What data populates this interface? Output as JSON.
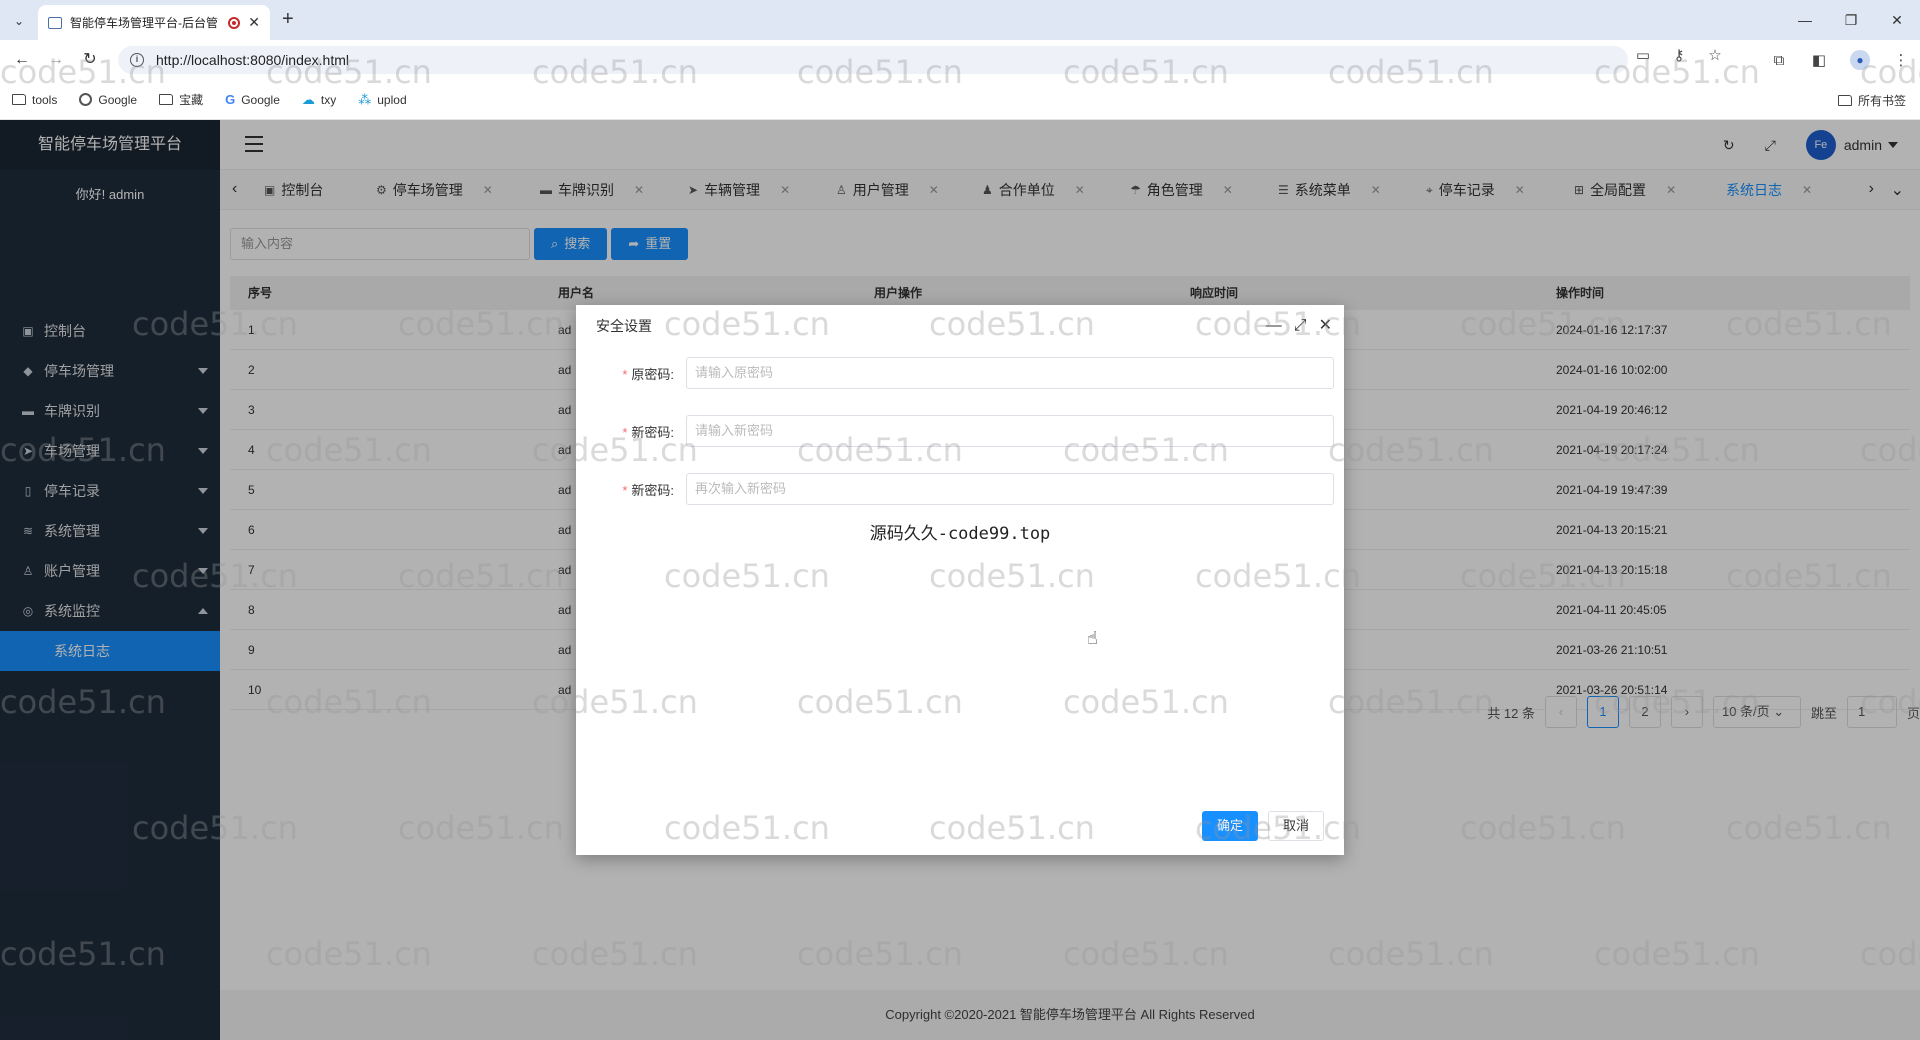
{
  "browser": {
    "tab_title": "智能停车场管理平台-后台管",
    "url": "http://localhost:8080/index.html",
    "bookmarks": [
      "tools",
      "Google",
      "宝藏",
      "Google",
      "txy",
      "uplod"
    ],
    "all_bookmarks": "所有书签"
  },
  "app": {
    "brand": "智能停车场管理平台",
    "greeting": "你好! admin",
    "user": "admin",
    "avatar_text": "Fe"
  },
  "sidebar": {
    "items": [
      {
        "label": "控制台",
        "icon": "dashboard-icon"
      },
      {
        "label": "停车场管理",
        "icon": "diamond-icon"
      },
      {
        "label": "车牌识别",
        "icon": "camera-icon"
      },
      {
        "label": "车场管理",
        "icon": "send-icon"
      },
      {
        "label": "停车记录",
        "icon": "doc-icon"
      },
      {
        "label": "系统管理",
        "icon": "layers-icon"
      },
      {
        "label": "账户管理",
        "icon": "user-icon"
      },
      {
        "label": "系统监控",
        "icon": "camera-icon"
      }
    ],
    "sub_active": "系统日志"
  },
  "tabs": [
    "控制台",
    "停车场管理",
    "车牌识别",
    "车辆管理",
    "用户管理",
    "合作单位",
    "角色管理",
    "系统菜单",
    "停车记录",
    "全局配置",
    "系统日志"
  ],
  "search": {
    "placeholder": "输入内容",
    "search_label": "搜索",
    "reset_label": "重置"
  },
  "table": {
    "headers": [
      "序号",
      "用户名",
      "用户操作",
      "响应时间",
      "操作时间"
    ],
    "rows": [
      {
        "no": "1",
        "user": "ad",
        "time": "2024-01-16 12:17:37"
      },
      {
        "no": "2",
        "user": "ad",
        "time": "2024-01-16 10:02:00"
      },
      {
        "no": "3",
        "user": "ad",
        "time": "2021-04-19 20:46:12"
      },
      {
        "no": "4",
        "user": "ad",
        "time": "2021-04-19 20:17:24"
      },
      {
        "no": "5",
        "user": "ad",
        "time": "2021-04-19 19:47:39"
      },
      {
        "no": "6",
        "user": "ad",
        "time": "2021-04-13 20:15:21"
      },
      {
        "no": "7",
        "user": "ad",
        "time": "2021-04-13 20:15:18"
      },
      {
        "no": "8",
        "user": "ad",
        "time": "2021-04-11 20:45:05"
      },
      {
        "no": "9",
        "user": "ad",
        "time": "2021-03-26 21:10:51"
      },
      {
        "no": "10",
        "user": "ad",
        "time": "2021-03-26 20:51:14"
      }
    ]
  },
  "pager": {
    "total": "共 12 条",
    "pages": [
      "1",
      "2"
    ],
    "page_size": "10 条/页",
    "jump_label": "跳至",
    "jump_value": "1",
    "page_unit": "页"
  },
  "footer": "Copyright ©2020-2021 智能停车场管理平台 All Rights Reserved",
  "dialog": {
    "title": "安全设置",
    "fields": [
      {
        "label": "原密码:",
        "placeholder": "请输入原密码"
      },
      {
        "label": "新密码:",
        "placeholder": "请输入新密码"
      },
      {
        "label": "新密码:",
        "placeholder": "再次输入新密码"
      }
    ],
    "note": "源码久久-code99.top",
    "ok_label": "确定",
    "cancel_label": "取消"
  },
  "watermark": "code51.cn",
  "colors": {
    "primary": "#1890ff",
    "sidebar_bg": "#1f2d3d",
    "required": "#f56c6c"
  }
}
